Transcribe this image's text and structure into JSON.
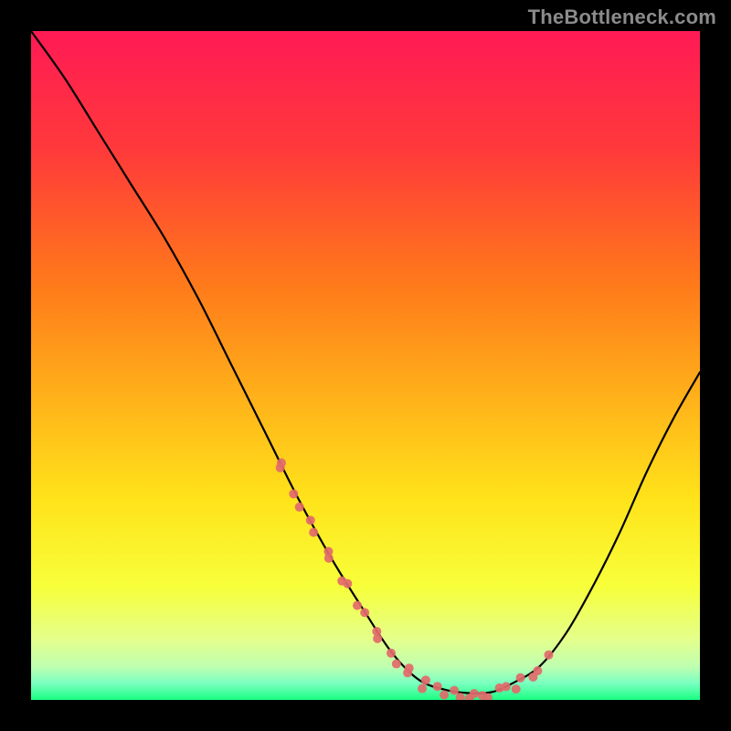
{
  "watermark": "TheBottleneck.com",
  "chart_data": {
    "type": "line",
    "title": "",
    "xlabel": "",
    "ylabel": "",
    "xlim": [
      0,
      100
    ],
    "ylim": [
      0,
      100
    ],
    "grid": false,
    "legend": false,
    "series": [
      {
        "name": "curve",
        "x": [
          0,
          5,
          10,
          15,
          20,
          25,
          30,
          35,
          40,
          45,
          50,
          54,
          58,
          62,
          66,
          69,
          72,
          76,
          80,
          84,
          88,
          92,
          96,
          100
        ],
        "y": [
          100,
          93,
          85,
          77,
          69,
          60,
          50,
          40,
          30,
          21,
          13,
          7,
          3,
          1.5,
          1,
          1.2,
          2.5,
          5,
          10,
          17,
          25,
          34,
          42,
          49
        ]
      }
    ],
    "markers": {
      "name": "dots",
      "x_ranges": [
        [
          37,
          49
        ],
        [
          49,
          69
        ],
        [
          69,
          78
        ]
      ],
      "description": "clusters of salmon dots along the curve in the trough region"
    },
    "background_gradient": {
      "top": "#ff1a55",
      "mid_upper": "#ff7a1a",
      "mid": "#ffe31a",
      "lower": "#f7ff3a",
      "bottom_band": "#e4ff8c",
      "base": "#1aff82"
    }
  }
}
